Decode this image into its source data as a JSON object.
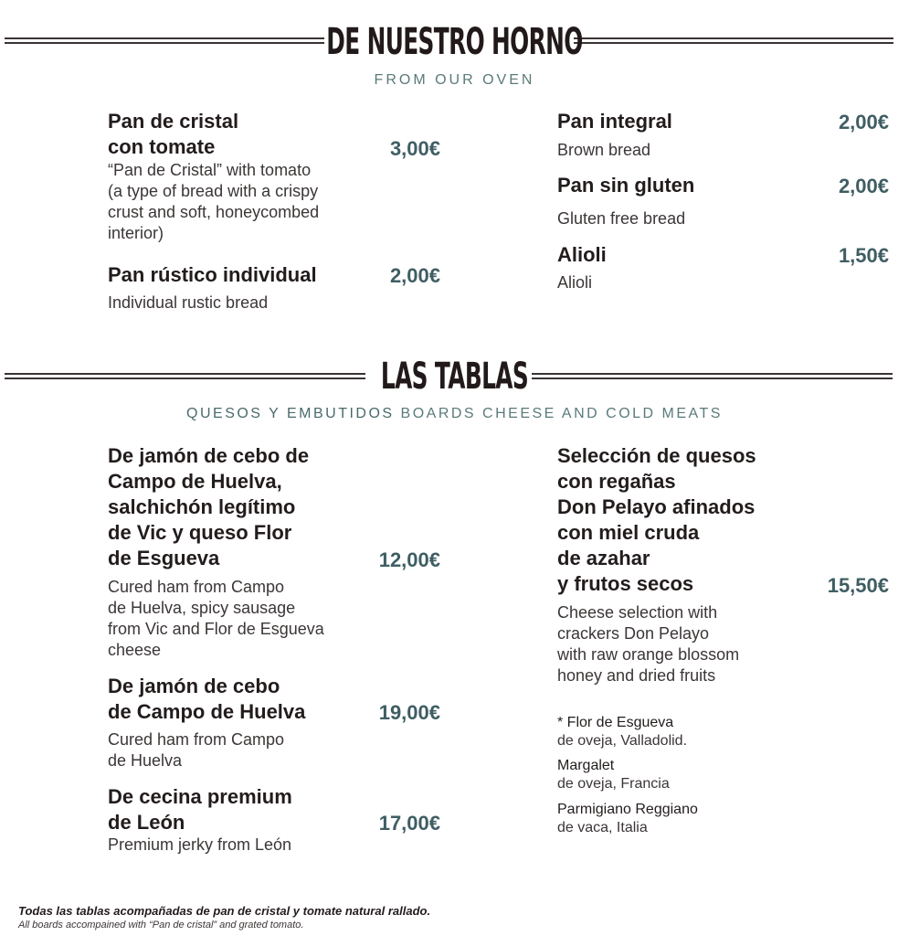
{
  "sections": {
    "oven": {
      "title": "DE NUESTRO HORNO",
      "subtitle": "FROM OUR OVEN",
      "items": [
        {
          "name": "Pan de cristal\ncon tomate",
          "price": "3,00€",
          "desc": "“Pan de Cristal” with tomato\n(a type of bread with a crispy\ncrust and soft, honeycombed\ninterior)"
        },
        {
          "name": "Pan rústico individual",
          "price": "2,00€",
          "desc": "Individual rustic bread"
        },
        {
          "name": "Pan integral",
          "price": "2,00€",
          "desc": "Brown bread"
        },
        {
          "name": "Pan sin gluten",
          "price": "2,00€",
          "desc": "Gluten free bread"
        },
        {
          "name": "Alioli",
          "price": "1,50€",
          "desc": "Alioli"
        }
      ]
    },
    "boards": {
      "title": "LAS TABLAS",
      "subtitle_es": "QUESOS Y EMBUTIDOS",
      "subtitle_en": "BOARDS CHEESE AND COLD MEATS",
      "items": [
        {
          "name": "De jamón de cebo de\nCampo de Huelva,\nsalchichón legítimo\nde Vic y queso Flor\nde Esgueva",
          "price": "12,00€",
          "desc": "Cured ham from Campo\nde Huelva, spicy sausage\nfrom Vic and Flor de Esgueva\ncheese"
        },
        {
          "name": "De jamón de cebo\nde Campo de Huelva",
          "price": "19,00€",
          "desc": "Cured ham from Campo\nde Huelva"
        },
        {
          "name": "De cecina premium\nde León",
          "price": "17,00€",
          "desc": "Premium jerky from León"
        },
        {
          "name": "Selección de quesos\ncon regañas\nDon Pelayo afinados\ncon miel cruda\nde azahar\ny frutos secos",
          "price": "15,50€",
          "desc": "Cheese selection with\ncrackers Don Pelayo\nwith raw orange blossom\nhoney and dried fruits"
        }
      ],
      "cheeses": [
        {
          "name": "* Flor de Esgueva",
          "desc": "de oveja, Valladolid."
        },
        {
          "name": "Margalet",
          "desc": "de oveja, Francia"
        },
        {
          "name": "Parmigiano Reggiano",
          "desc": "de vaca, Italia"
        }
      ]
    }
  },
  "footer": {
    "es": "Todas las tablas acompañadas de pan de cristal y tomate natural rallado.",
    "en": "All boards accompained with “Pan de cristal” and grated tomato."
  }
}
